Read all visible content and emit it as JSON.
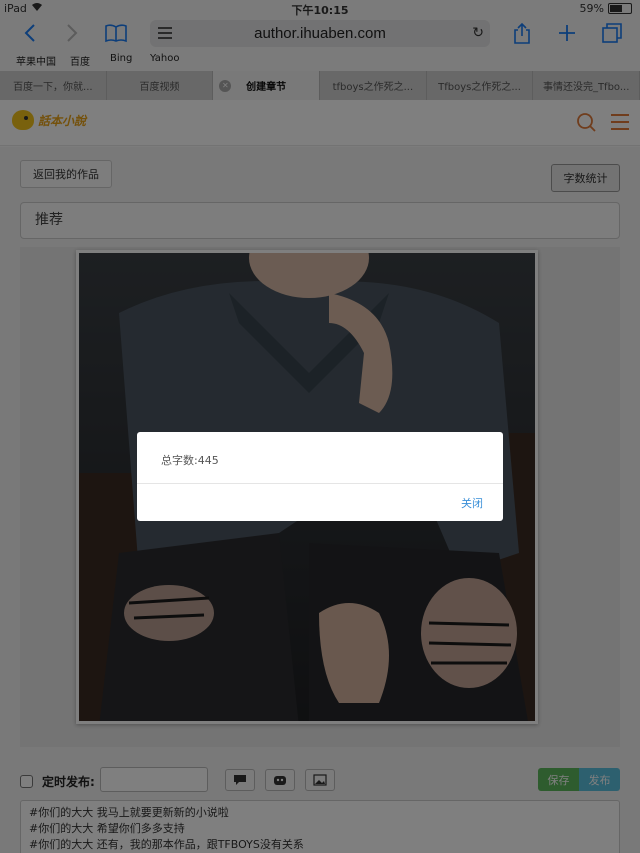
{
  "status_bar": {
    "device": "iPad",
    "time": "下午10:15",
    "battery": "59%",
    "battery_level": 0.59
  },
  "browser": {
    "url": "author.ihuaben.com",
    "bookmarks": [
      "苹果中国",
      "百度",
      "Bing",
      "Yahoo"
    ],
    "tabs": [
      {
        "label": "百度一下，你就...",
        "active": false
      },
      {
        "label": "百度视频",
        "active": false
      },
      {
        "label": "创建章节",
        "active": true
      },
      {
        "label": "tfboys之作死之...",
        "active": false
      },
      {
        "label": "Tfboys之作死之...",
        "active": false
      },
      {
        "label": "事情还没完_Tfbo...",
        "active": false
      }
    ]
  },
  "site": {
    "logo_text": "話本小說",
    "icons": [
      "search-icon",
      "menu-icon"
    ],
    "accent_color": "#e07b3a"
  },
  "page": {
    "back_button": "返回我的作品",
    "word_count_button": "字数统计",
    "chapter_title": "推荐",
    "schedule_label": "定时发布:",
    "schedule_value": "",
    "tools": [
      "comment-icon",
      "emoji-icon",
      "image-icon"
    ],
    "save_label": "保存",
    "publish_label": "发布",
    "body_lines": [
      "#你们的大大 我马上就要更新新的小说啦",
      "#你们的大大 希望你们多多支持",
      "#你们的大大 还有，我的那本作品，跟TFBOYS没有关系"
    ]
  },
  "dialog": {
    "message": "总字数:445",
    "close_label": "关闭"
  }
}
